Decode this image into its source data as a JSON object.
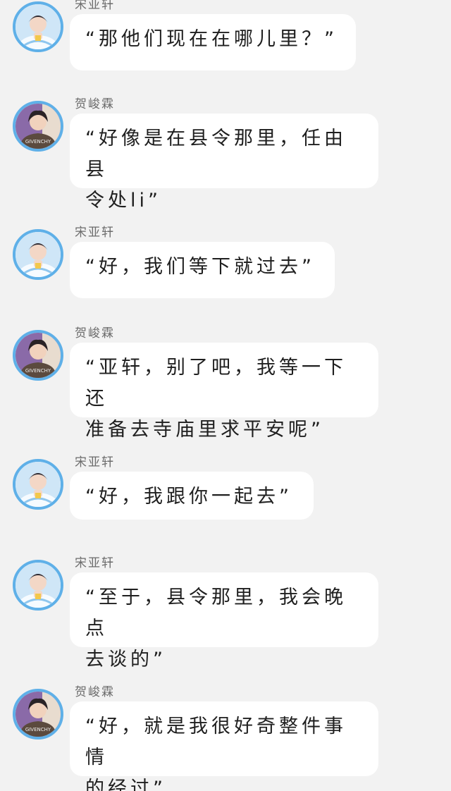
{
  "messages": [
    {
      "sender": "宋亚轩",
      "avatar": "song",
      "text": "“那他们现在在哪儿里？”",
      "bubble_w": 406,
      "lines": 1
    },
    {
      "sender": "贺峻霖",
      "avatar": "he",
      "text": "“好像是在县令那里，任由县\n令处li”",
      "bubble_w": 438,
      "lines": 2
    },
    {
      "sender": "宋亚轩",
      "avatar": "song",
      "text": "“好，我们等下就过去”",
      "bubble_w": 376,
      "lines": 1
    },
    {
      "sender": "贺峻霖",
      "avatar": "he",
      "text": "“亚轩，别了吧，我等一下还\n准备去寺庙里求平安呢”",
      "bubble_w": 438,
      "lines": 2
    },
    {
      "sender": "宋亚轩",
      "avatar": "song",
      "text": "“好，我跟你一起去”",
      "bubble_w": 346,
      "lines": 1
    },
    {
      "sender": "宋亚轩",
      "avatar": "song",
      "text": "“至于，县令那里，我会晚点\n去谈的”",
      "bubble_w": 438,
      "lines": 2
    },
    {
      "sender": "贺峻霖",
      "avatar": "he",
      "text": "“好，就是我很好奇整件事情\n的经过”",
      "bubble_w": 438,
      "lines": 2
    }
  ]
}
